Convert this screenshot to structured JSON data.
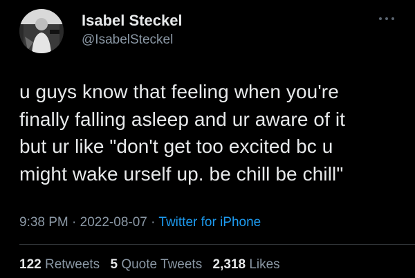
{
  "author": {
    "display_name": "Isabel Steckel",
    "handle": "@IsabelSteckel",
    "avatar_icon": "profile-photo-avatar"
  },
  "tweet": {
    "text": "u guys know that feeling when you're\nfinally falling asleep and ur aware of it\nbut ur like \"don't get too excited bc u\nmight wake urself up. be chill be chill\"",
    "time": "9:38 PM",
    "separator": "·",
    "date": "2022-08-07",
    "source": "Twitter for iPhone"
  },
  "stats": {
    "retweets_count": "122",
    "retweets_label": "Retweets",
    "quote_tweets_count": "5",
    "quote_tweets_label": "Quote Tweets",
    "likes_count": "2,318",
    "likes_label": "Likes"
  },
  "colors": {
    "background": "#000000",
    "primary_text": "#e7e9ea",
    "secondary_text": "#8b98a5",
    "link": "#1d9bf0",
    "divider": "#2f3336"
  }
}
